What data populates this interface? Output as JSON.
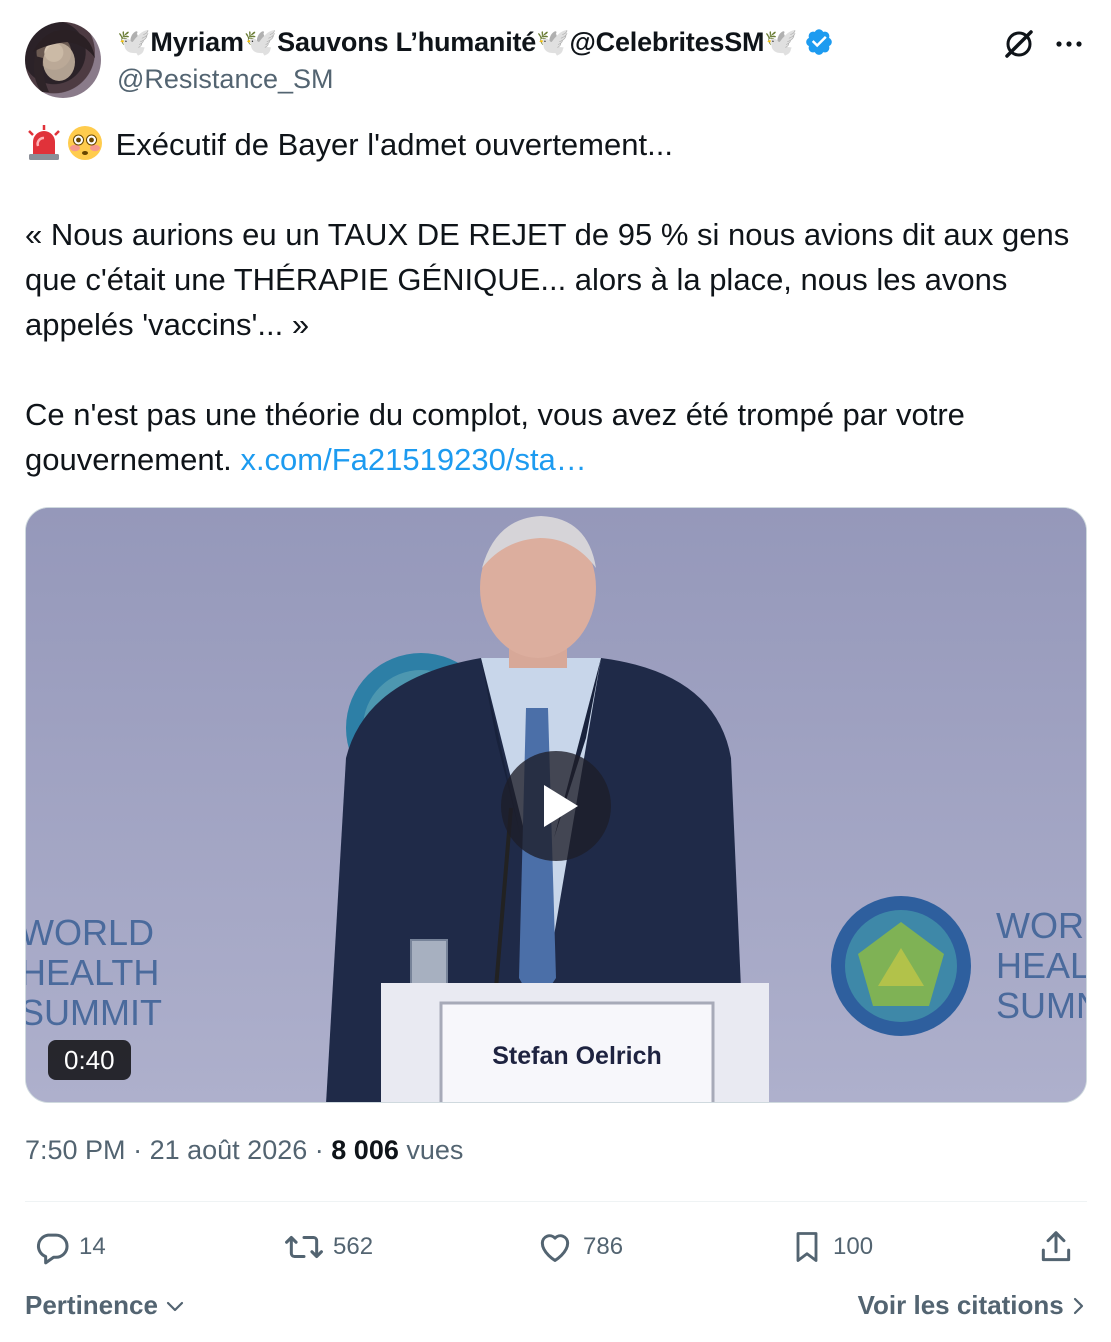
{
  "author": {
    "display_name": "🕊️Myriam🕊️Sauvons L’humanité🕊️@CelebritesSM🕊️",
    "handle": "@Resistance_SM",
    "verified": true
  },
  "tweet": {
    "line1": "Exécutif de Bayer l'admet ouvertement...",
    "line1_emojis": [
      "rotating-light-icon",
      "flushed-face-icon"
    ],
    "quote": "« Nous aurions eu un TAUX DE REJET de 95 % si nous avions dit aux gens que c'était une THÉRAPIE GÉNIQUE... alors à la place, nous les avons appelés 'vaccins'... »",
    "closing": "Ce n'est pas une théorie du complot, vous avez été trompé par votre gouvernement.",
    "link": "x.com/Fa21519230/sta…"
  },
  "media": {
    "duration": "0:40",
    "podium_name": "Stefan Oelrich",
    "backdrop_left": [
      "WORLD",
      "HEALTH",
      "SUMMIT"
    ],
    "backdrop_right": [
      "WOR",
      "HEAL",
      "SUMN"
    ]
  },
  "meta": {
    "time": "7:50 PM",
    "separator": "·",
    "date": "21 août 2026",
    "views_count": "8 006",
    "views_label": "vues"
  },
  "actions": {
    "replies": "14",
    "reposts": "562",
    "likes": "786",
    "bookmarks": "100"
  },
  "footer": {
    "sort_label": "Pertinence",
    "quotes_label": "Voir les citations"
  },
  "colors": {
    "link": "#1d9bf0",
    "secondary_text": "#536471",
    "verified_badge": "#1d9bf0"
  }
}
